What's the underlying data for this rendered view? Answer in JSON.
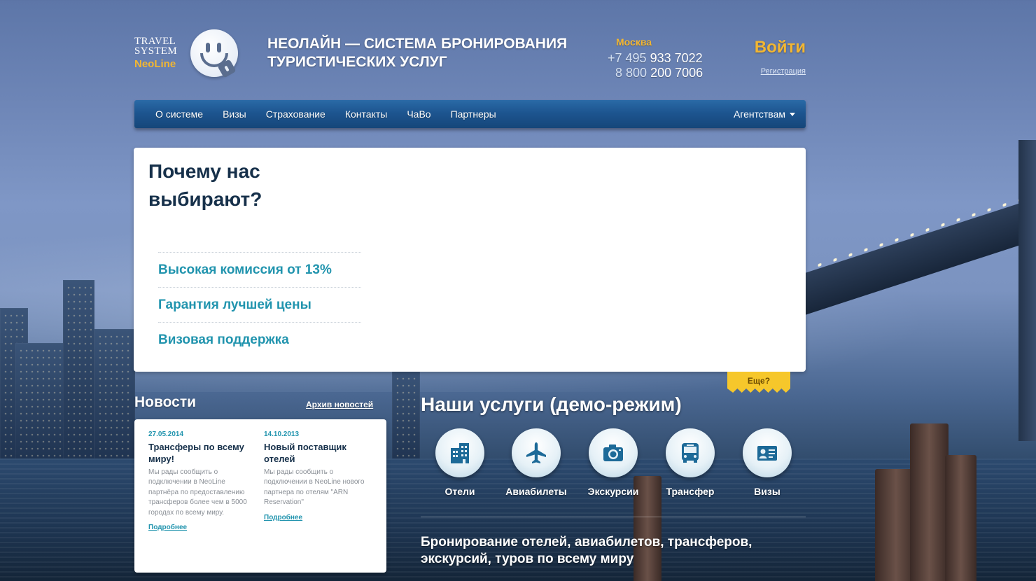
{
  "brand": {
    "line1": "TRAVEL",
    "line2": "SYSTEM",
    "line3": "NeoLine",
    "accent_color": "#f2b632",
    "logo_icon": "smiley-lock-icon"
  },
  "header": {
    "headline": "НЕОЛАЙН — СИСТЕМА БРОНИРОВАНИЯ ТУРИСТИЧЕСКИХ УСЛУГ",
    "city": "Москва",
    "phones": [
      {
        "prefix": "+7 495",
        "number": "933 7022"
      },
      {
        "prefix": "8 800",
        "number": "200 7006"
      }
    ],
    "login_label": "Войти",
    "register_label": "Регистрация"
  },
  "nav": {
    "items": [
      {
        "label": "О системе"
      },
      {
        "label": "Визы"
      },
      {
        "label": "Страхование"
      },
      {
        "label": "Контакты"
      },
      {
        "label": "ЧаВо"
      },
      {
        "label": "Партнеры"
      }
    ],
    "dropdown_label": "Агентствам",
    "color": "#1d5590"
  },
  "why": {
    "title": "Почему нас выбирают?",
    "items": [
      {
        "label": "Высокая комиссия от 13%"
      },
      {
        "label": "Гарантия лучшей цены"
      },
      {
        "label": "Визовая поддержка"
      }
    ],
    "more_label": "Еще?"
  },
  "news": {
    "title": "Новости",
    "archive_label": "Архив новостей",
    "items": [
      {
        "date": "27.05.2014",
        "headline": "Трансферы по всему миру!",
        "text": "Мы рады сообщить о подключении в NeoLine партнёра по предоставлению трансферов более чем в 5000 городах по всему миру.",
        "more": "Подробнее"
      },
      {
        "date": "14.10.2013",
        "headline": "Новый поставщик отелей",
        "text": "Мы рады сообщить о подключении в NeoLine нового партнера по отелям \"ARN Reservation\"",
        "more": "Подробнее"
      }
    ]
  },
  "services": {
    "title": "Наши услуги (демо-режим)",
    "items": [
      {
        "label": "Отели",
        "icon": "hotel-icon"
      },
      {
        "label": "Авиабилеты",
        "icon": "airplane-icon"
      },
      {
        "label": "Экскурсии",
        "icon": "camera-icon"
      },
      {
        "label": "Трансфер",
        "icon": "bus-icon"
      },
      {
        "label": "Визы",
        "icon": "visa-card-icon"
      }
    ],
    "description": "Бронирование отелей, авиабилетов, трансферов, экскурсий, туров по всему миру",
    "icon_color": "#1d6a98"
  }
}
